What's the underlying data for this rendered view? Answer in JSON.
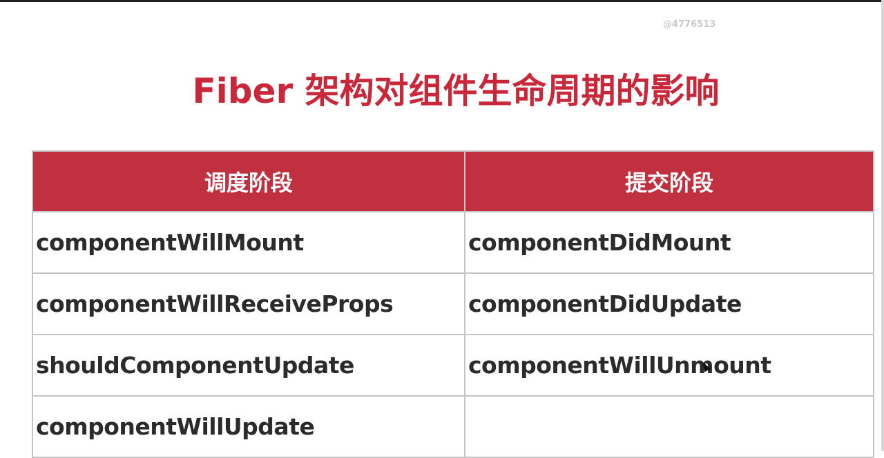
{
  "watermark": "@4776513",
  "title": "Fiber 架构对组件生命周期的影响",
  "table": {
    "headers": [
      "调度阶段",
      "提交阶段"
    ],
    "rows": [
      [
        "componentWillMount",
        "componentDidMount"
      ],
      [
        "componentWillReceiveProps",
        "componentDidUpdate"
      ],
      [
        "shouldComponentUpdate",
        "componentWillUnmount"
      ],
      [
        "componentWillUpdate",
        ""
      ]
    ]
  },
  "colors": {
    "accent": "#c8283a",
    "header_bg": "#c0303f",
    "cell_text": "#2b2b2b",
    "border": "#c4c4c4"
  }
}
